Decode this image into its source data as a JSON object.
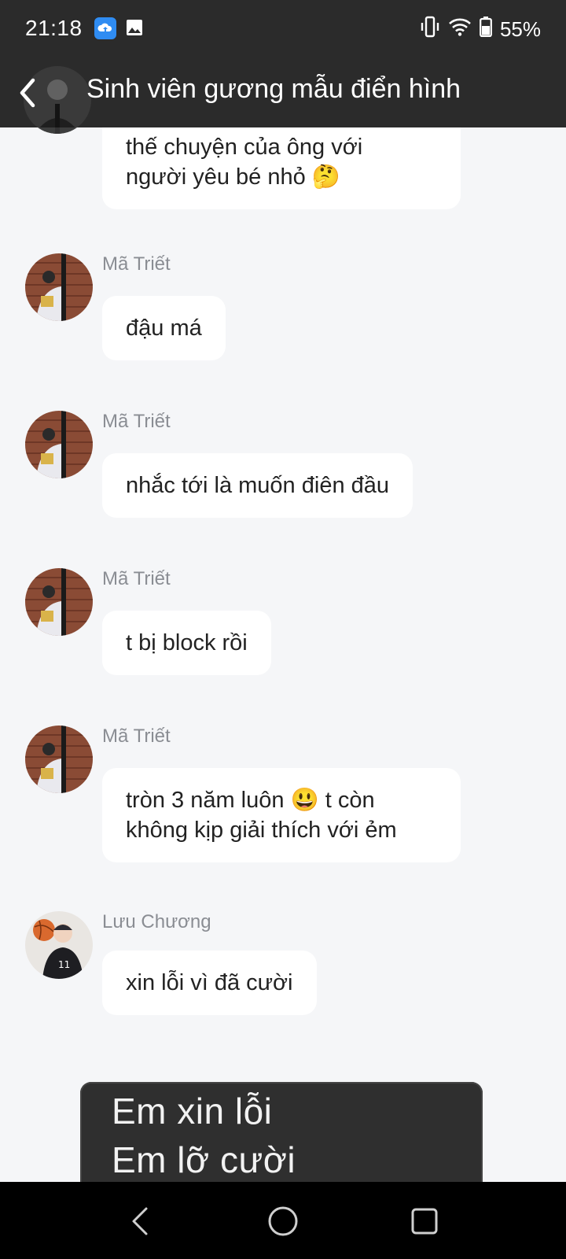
{
  "status_bar": {
    "time": "21:18",
    "battery": "55%",
    "icons": [
      "cloud-upload-icon",
      "gallery-icon",
      "vibrate-icon",
      "wifi-icon",
      "battery-icon"
    ]
  },
  "header": {
    "title": "Sinh viên gương mẫu điển hình",
    "back_icon": "chevron-left-icon"
  },
  "messages": [
    {
      "sender": "",
      "lines": [
        "thế chuyện của ông với",
        "người yêu bé nhỏ 🤔"
      ]
    },
    {
      "sender": "Mã Triết",
      "lines": [
        "đậu má"
      ]
    },
    {
      "sender": "Mã Triết",
      "lines": [
        "nhắc tới là muốn điên đầu"
      ]
    },
    {
      "sender": "Mã Triết",
      "lines": [
        "t bị block rồi"
      ]
    },
    {
      "sender": "Mã Triết",
      "lines": [
        "tròn 3 năm luôn 😃 t còn",
        "không kịp giải thích với ẻm"
      ]
    },
    {
      "sender": "Lưu Chương",
      "lines": [
        "xin lỗi vì đã cười"
      ]
    }
  ],
  "video_overlay": {
    "line1": "Em xin lỗi",
    "line2": "Em lỡ cười"
  },
  "nav_bar": {
    "icons": [
      "nav-back-icon",
      "nav-home-icon",
      "nav-recents-icon"
    ]
  },
  "colors": {
    "bar_bg": "#2b2b2b",
    "chat_bg": "#f5f6f8",
    "bubble_bg": "#ffffff",
    "sender_text": "#8a8d93"
  }
}
